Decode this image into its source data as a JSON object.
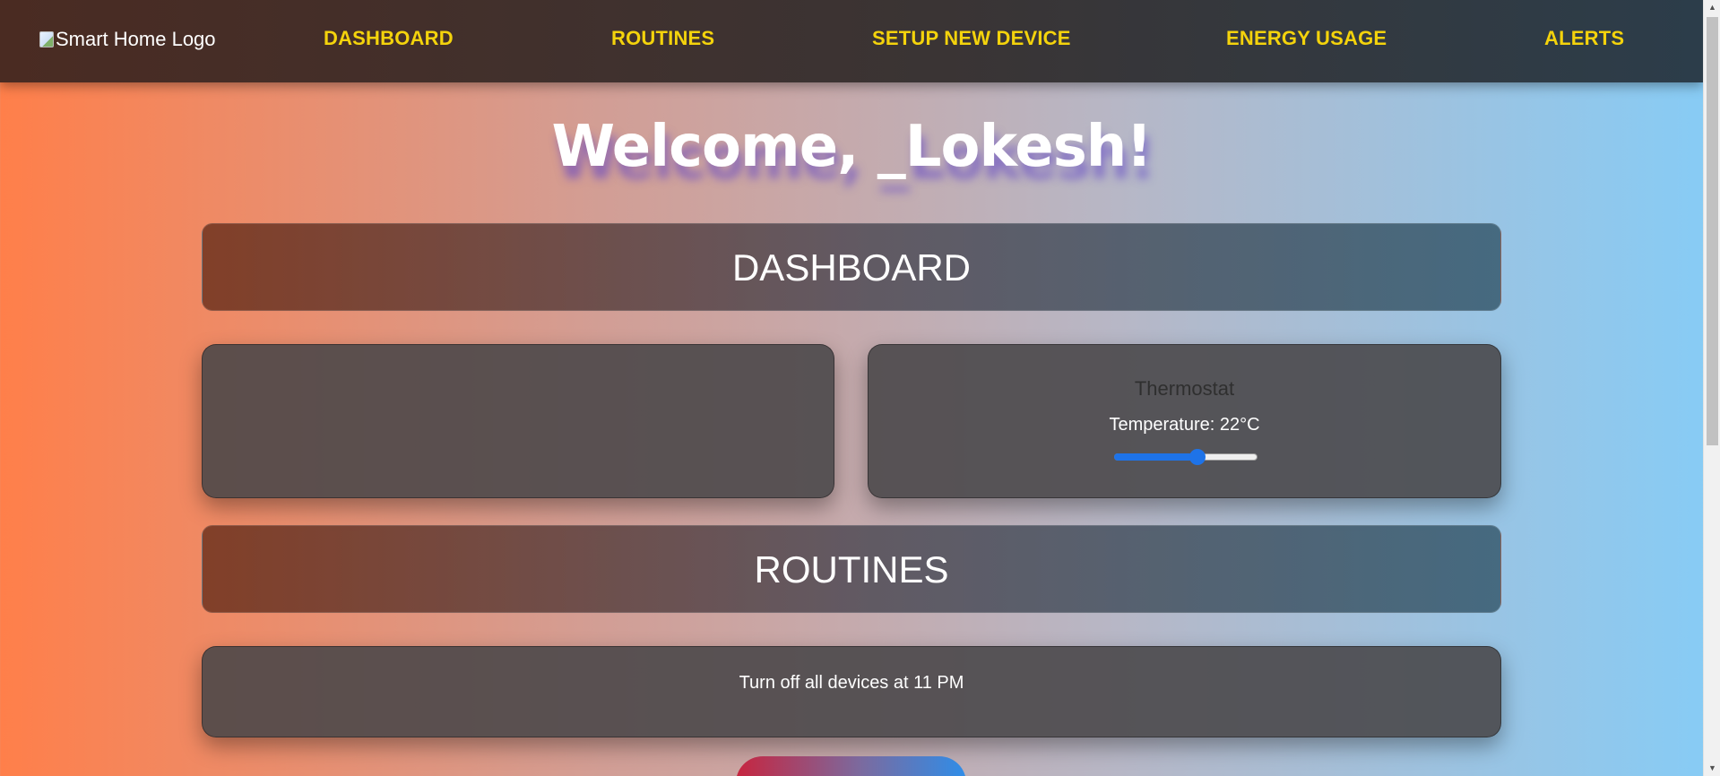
{
  "nav": {
    "logo_alt": "Smart Home Logo",
    "links": [
      "DASHBOARD",
      "ROUTINES",
      "SETUP NEW DEVICE",
      "ENERGY USAGE",
      "ALERTS"
    ]
  },
  "welcome": "Welcome, _Lokesh!",
  "dashboard": {
    "heading": "DASHBOARD",
    "thermostat": {
      "title": "Thermostat",
      "temperature_text": "Temperature: 22°C",
      "slider_fraction": 0.59
    }
  },
  "routines": {
    "heading": "ROUTINES",
    "items": [
      "Turn off all devices at 11 PM"
    ]
  },
  "colors": {
    "nav_link": "#f4d30c",
    "slider": "#1e73e8"
  }
}
